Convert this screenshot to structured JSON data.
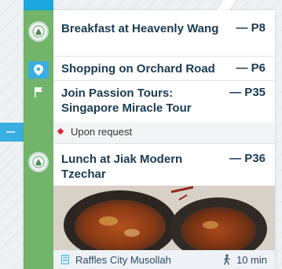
{
  "itinerary": {
    "items": [
      {
        "title": "Breakfast at Heavenly Wang",
        "page": "— P8",
        "icon": "restaurant-badge-icon"
      },
      {
        "title": "Shopping on Orchard Road",
        "page": "— P6",
        "icon": "location-pin-icon"
      },
      {
        "title": "Join Passion Tours: Singapore Miracle Tour",
        "page": "— P35",
        "icon": "flag-icon"
      },
      {
        "title": "Lunch at Jiak Modern Tzechar",
        "page": "— P36",
        "icon": "restaurant-badge-icon"
      }
    ],
    "note": "Upon request",
    "footer": {
      "place": "Raffles City Musollah",
      "walk_time": "10 min"
    }
  },
  "side_tab": {
    "label": "– –"
  },
  "colors": {
    "rail_green": "#72b46a",
    "title_navy": "#1a3a52",
    "accent_blue": "#1ea7df",
    "note_red": "#e2253a"
  }
}
